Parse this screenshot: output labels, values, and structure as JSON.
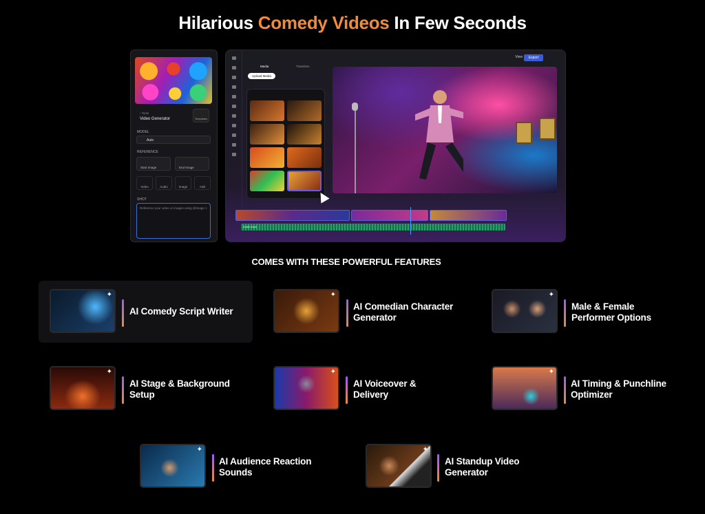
{
  "headline": {
    "part1": "Hilarious ",
    "accent": "Comedy Videos",
    "part2": " In Few Seconds",
    "accent_color": "#f08a3c"
  },
  "generator_panel": {
    "back_label": "Tools",
    "title": "Video Generator",
    "templates_label": "Templates",
    "model_label": "MODEL",
    "model_value": "Auto",
    "reference_label": "REFERENCE",
    "start_image": "Start Image",
    "end_image": "End Image",
    "tools": [
      "Video",
      "Audio",
      "Image",
      "Add"
    ],
    "shot_label": "SHOT",
    "prompt_placeholder": "Reference your video or images using @image 1"
  },
  "editor": {
    "tabs": [
      "Media",
      "Transition"
    ],
    "upload_label": "Upload Media",
    "view_label": "View",
    "export_label": "Export",
    "audio_track_label": "Audio track"
  },
  "features_heading": "COMES WITH THESE  POWERFUL FEATURES",
  "features": [
    {
      "label": "AI Comedy Script Writer"
    },
    {
      "label": "AI Comedian Character Generator"
    },
    {
      "label": "Male & Female Performer Options"
    },
    {
      "label": "AI Stage & Background Setup"
    },
    {
      "label": "AI Voiceover & Delivery"
    },
    {
      "label": "AI Timing & Punchline Optimizer"
    },
    {
      "label": "AI Audience Reaction Sounds"
    },
    {
      "label": "AI Standup Video Generator"
    }
  ],
  "colors": {
    "bar_gradient_top": "#9b5cf6",
    "bar_gradient_bottom": "#f08a3c",
    "export_button": "#3b5bdb"
  }
}
